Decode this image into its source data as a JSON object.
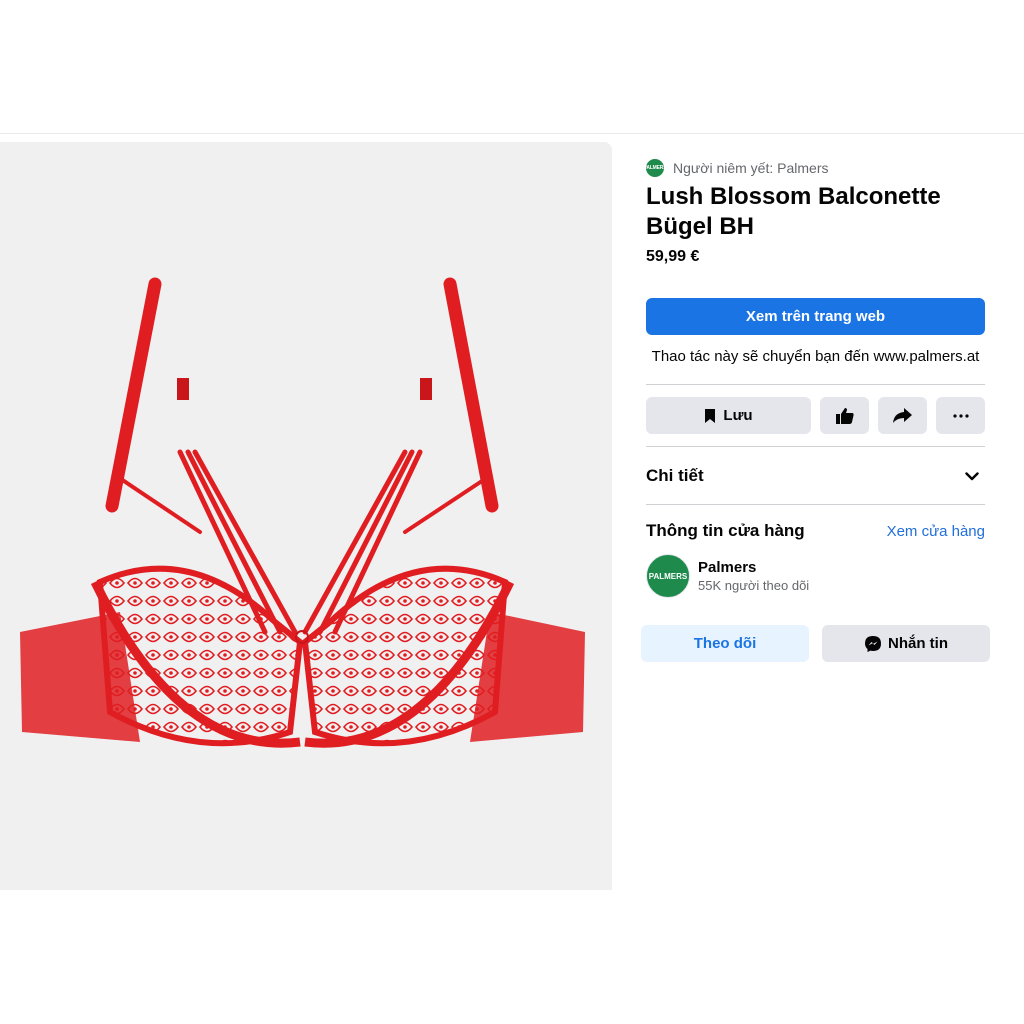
{
  "seller": {
    "logo_text": "PALMERS",
    "listed_by": "Người niêm yết: Palmers"
  },
  "product": {
    "title": "Lush Blossom Balconette Bügel BH",
    "price": "59,99 €",
    "image_icon": "red-lace-bra-image"
  },
  "actions": {
    "view_on_web": "Xem trên trang web",
    "redirect_note": "Thao tác này sẽ chuyển bạn đến www.palmers.at",
    "save_label": "Lưu"
  },
  "details": {
    "label": "Chi tiết"
  },
  "store": {
    "heading": "Thông tin cửa hàng",
    "view_store": "Xem cửa hàng",
    "avatar_text": "PALMERS",
    "name": "Palmers",
    "followers": "55K người theo dõi",
    "follow_label": "Theo dõi",
    "message_label": "Nhắn tin"
  },
  "colors": {
    "primary": "#1b74e4",
    "brand_green": "#1e8b4c",
    "secondary_bg": "#e4e6eb",
    "product_red": "#e01e22"
  }
}
